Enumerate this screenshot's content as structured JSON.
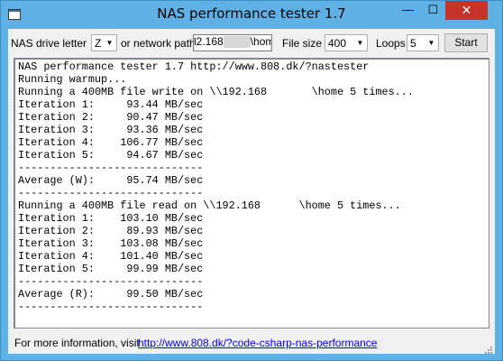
{
  "window": {
    "title": "NAS performance tester 1.7",
    "minimize_glyph": "—",
    "maximize_glyph": "☐",
    "close_glyph": "✕"
  },
  "toolbar": {
    "drive_letter_label": "NAS drive letter",
    "drive_letter_value": "Z",
    "network_path_label": "or network path",
    "network_path_prefix": "l2.168",
    "network_path_suffix": "\\home",
    "file_size_label": "File size",
    "file_size_value": "400",
    "loops_label": "Loops",
    "loops_value": "5",
    "start_label": "Start"
  },
  "output": {
    "lines": [
      "NAS performance tester 1.7 http://www.808.dk/?nastester",
      "Running warmup...",
      "Running a 400MB file write on \\\\192.168       \\home 5 times...",
      "Iteration 1:     93.44 MB/sec",
      "Iteration 2:     90.47 MB/sec",
      "Iteration 3:     93.36 MB/sec",
      "Iteration 4:    106.77 MB/sec",
      "Iteration 5:     94.67 MB/sec",
      "-----------------------------",
      "Average (W):     95.74 MB/sec",
      "-----------------------------",
      "Running a 400MB file read on \\\\192.168      \\home 5 times...",
      "Iteration 1:    103.10 MB/sec",
      "Iteration 2:     89.93 MB/sec",
      "Iteration 3:    103.08 MB/sec",
      "Iteration 4:    101.40 MB/sec",
      "Iteration 5:     99.99 MB/sec",
      "-----------------------------",
      "Average (R):     99.50 MB/sec",
      "-----------------------------"
    ]
  },
  "footer": {
    "info_text": "For more information, visit",
    "link_text": "http://www.808.dk/?code-csharp-nas-performance"
  },
  "colors": {
    "titlebar": "#5eb0e5",
    "close_button": "#c7332b",
    "client_background": "#f0f0f0",
    "link": "#0000ee"
  }
}
